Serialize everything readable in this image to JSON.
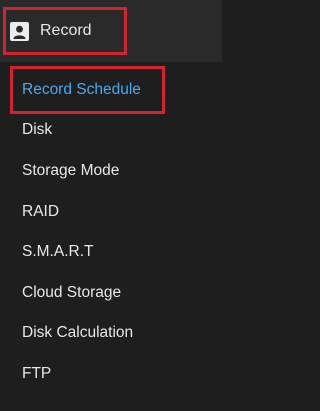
{
  "header": {
    "label": "Record",
    "icon": "record-icon"
  },
  "submenu": {
    "items": [
      {
        "label": "Record Schedule",
        "active": true
      },
      {
        "label": "Disk"
      },
      {
        "label": "Storage Mode"
      },
      {
        "label": "RAID"
      },
      {
        "label": "S.M.A.R.T"
      },
      {
        "label": "Cloud Storage"
      },
      {
        "label": "Disk Calculation"
      },
      {
        "label": "FTP"
      }
    ]
  },
  "colors": {
    "active_item": "#4aa8ee",
    "highlight_box": "#d3232f",
    "background": "#1e1e1e",
    "header_background": "#2a2a2a"
  }
}
